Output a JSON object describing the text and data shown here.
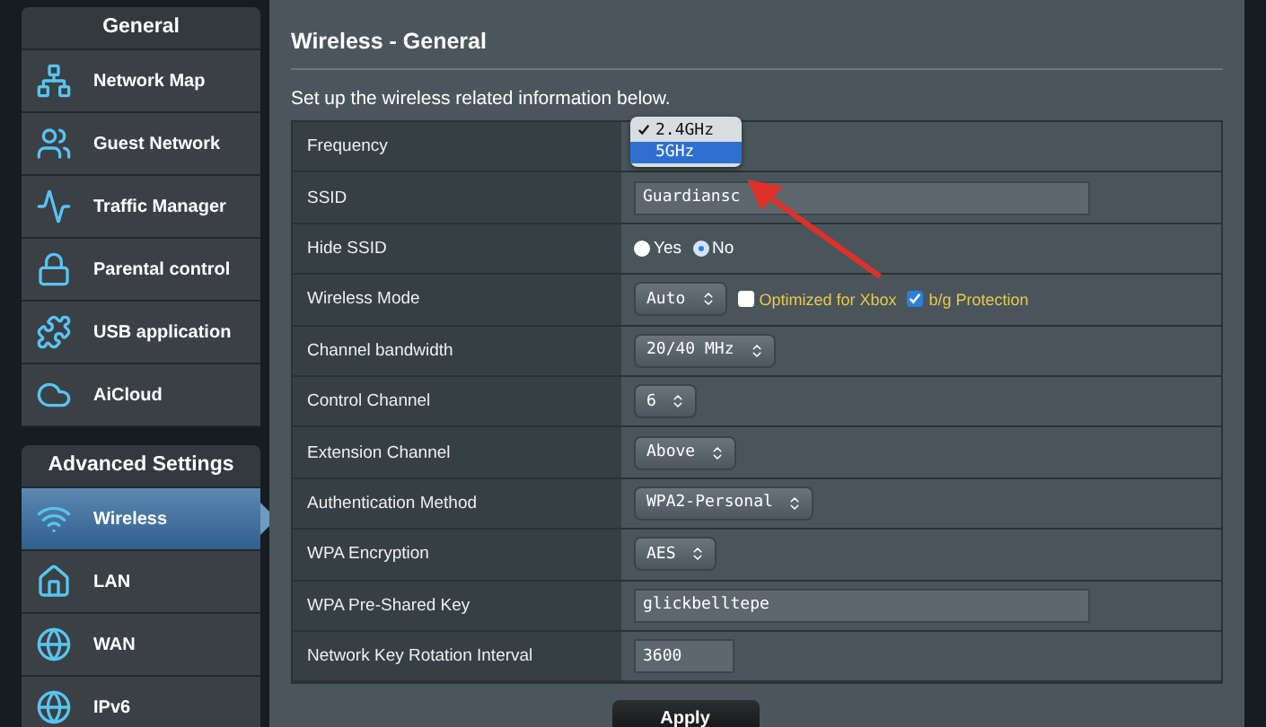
{
  "sidebar": {
    "sections": [
      {
        "title": "General",
        "items": [
          {
            "label": "Network Map",
            "selected": false
          },
          {
            "label": "Guest Network",
            "selected": false
          },
          {
            "label": "Traffic Manager",
            "selected": false
          },
          {
            "label": "Parental control",
            "selected": false
          },
          {
            "label": "USB application",
            "selected": false
          },
          {
            "label": "AiCloud",
            "selected": false
          }
        ]
      },
      {
        "title": "Advanced Settings",
        "items": [
          {
            "label": "Wireless",
            "selected": true
          },
          {
            "label": "LAN",
            "selected": false
          },
          {
            "label": "WAN",
            "selected": false
          },
          {
            "label": "IPv6",
            "selected": false
          }
        ]
      }
    ]
  },
  "main": {
    "title": "Wireless - General",
    "description": "Set up the wireless related information below.",
    "rows": [
      {
        "label": "Frequency",
        "kind": "dropdown",
        "options": [
          {
            "label": "2.4GHz",
            "checked": true,
            "selected": false
          },
          {
            "label": "5GHz",
            "checked": false,
            "selected": true
          }
        ]
      },
      {
        "label": "SSID",
        "kind": "input",
        "value": "Guardiansc"
      },
      {
        "label": "Hide SSID",
        "kind": "radio",
        "options": [
          {
            "label": "Yes",
            "selected": false
          },
          {
            "label": "No",
            "selected": true
          }
        ]
      },
      {
        "label": "Wireless Mode",
        "kind": "select",
        "value": "Auto",
        "checks": [
          {
            "label": "Optimized for Xbox",
            "checked": false
          },
          {
            "label": "b/g Protection",
            "checked": true
          }
        ]
      },
      {
        "label": "Channel bandwidth",
        "kind": "select",
        "value": "20/40 MHz"
      },
      {
        "label": "Control Channel",
        "kind": "select",
        "value": "6"
      },
      {
        "label": "Extension Channel",
        "kind": "select",
        "value": "Above"
      },
      {
        "label": "Authentication Method",
        "kind": "select",
        "value": "WPA2-Personal"
      },
      {
        "label": "WPA Encryption",
        "kind": "select",
        "value": "AES"
      },
      {
        "label": "WPA Pre-Shared Key",
        "kind": "input",
        "value": "glickbelltepe"
      },
      {
        "label": "Network Key Rotation Interval",
        "kind": "short-input",
        "value": "3600"
      }
    ],
    "apply_button": "Apply"
  }
}
